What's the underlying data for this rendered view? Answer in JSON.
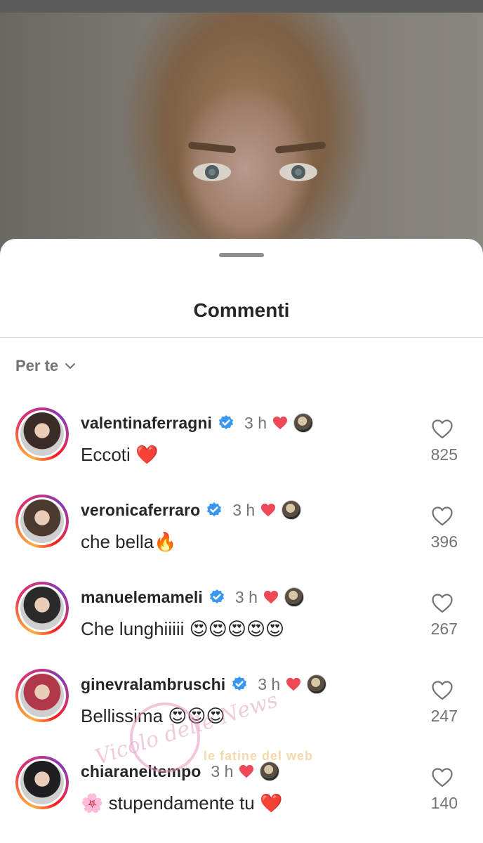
{
  "sheet": {
    "title": "Commenti",
    "filter_label": "Per te"
  },
  "comments": [
    {
      "username": "valentinaferragni",
      "time": "3 h",
      "text": "Eccoti ❤️",
      "likes": "825",
      "verified": true,
      "avatar_color": "#3a2c27"
    },
    {
      "username": "veronicaferraro",
      "time": "3 h",
      "text": "che bella🔥",
      "likes": "396",
      "verified": true,
      "avatar_color": "#4a3a30"
    },
    {
      "username": "manuelemameli",
      "time": "3 h",
      "text": "Che lunghiiiii 😍😍😍😍😍",
      "likes": "267",
      "verified": true,
      "avatar_color": "#2a2a2a"
    },
    {
      "username": "ginevralambruschi",
      "time": "3 h",
      "text": "Bellissima 😍😍😍",
      "likes": "247",
      "verified": true,
      "avatar_color": "#b0384a"
    },
    {
      "username": "chiaraneltempo",
      "time": "3 h",
      "text": "🌸 stupendamente tu ❤️",
      "likes": "140",
      "verified": false,
      "avatar_color": "#1f1f22"
    }
  ],
  "watermark": {
    "script_text": "Vicolo delle News",
    "banner_text": "le fatine del web"
  },
  "colors": {
    "verified_blue": "#3897f0",
    "heart_red": "#ed4956",
    "secondary_text": "#737373"
  }
}
